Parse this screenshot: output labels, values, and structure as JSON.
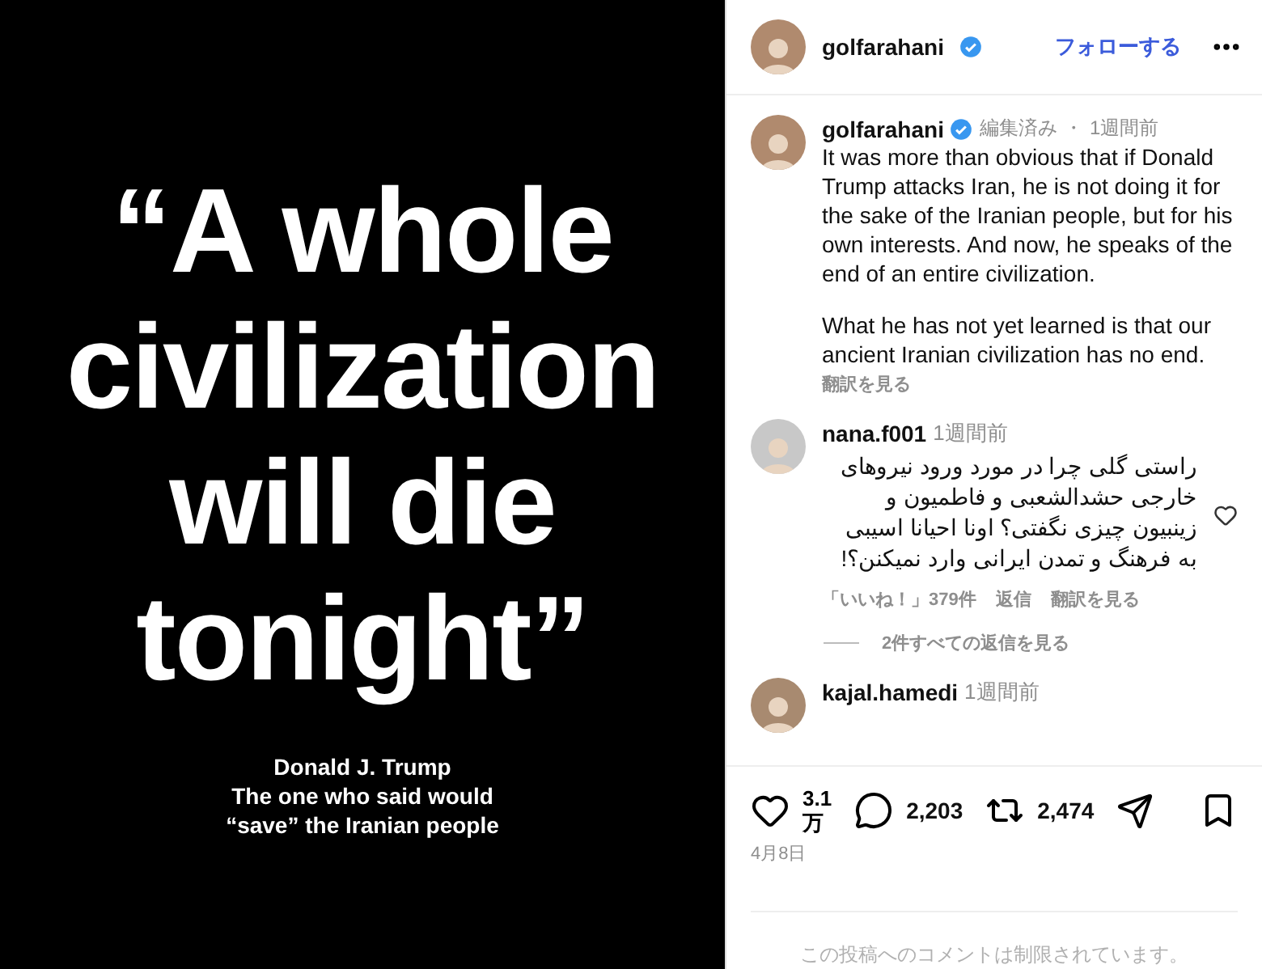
{
  "post_image": {
    "quote_lines": [
      "“A whole",
      "civilization",
      "will die",
      "tonight”"
    ],
    "caption_lines": [
      "Donald J. Trump",
      "The one who said would",
      "“save” the Iranian people"
    ]
  },
  "header": {
    "username": "golfarahani",
    "verified": true,
    "follow": "フォローする"
  },
  "caption": {
    "username": "golfarahani",
    "verified": true,
    "edited": "編集済み",
    "separator": "・",
    "time": "1週間前",
    "paragraphs": [
      "It was more than obvious that if Donald Trump attacks Iran, he is not doing it for the sake of the Iranian people, but for his own interests. And now, he speaks of the end of an entire civilization.",
      "What he has not yet learned is that our ancient Iranian civilization has no end."
    ],
    "translate": "翻訳を見る"
  },
  "comments": [
    {
      "username": "nana.f001",
      "time": "1週間前",
      "text": "راستی گلی چرا در مورد ورود نیروهای خارجی حشدالشعبی و فاطمیون و زینبیون چیزی نگفتی؟ اونا احیانا اسیبی به فرهنگ و تمدن ایرانی وارد نمیکنن؟!",
      "liked": false,
      "likes": "「いいね！」379件",
      "reply": "返信",
      "translate": "翻訳を見る",
      "view_replies": "2件すべての返信を見る"
    },
    {
      "username": "kajal.hamedi",
      "time": "1週間前"
    }
  ],
  "actions": {
    "likes": [
      "3.1",
      "万"
    ],
    "comments": "2,203",
    "reposts": "2,474"
  },
  "date": "4月8日",
  "footer": "この投稿へのコメントは制限されています。"
}
